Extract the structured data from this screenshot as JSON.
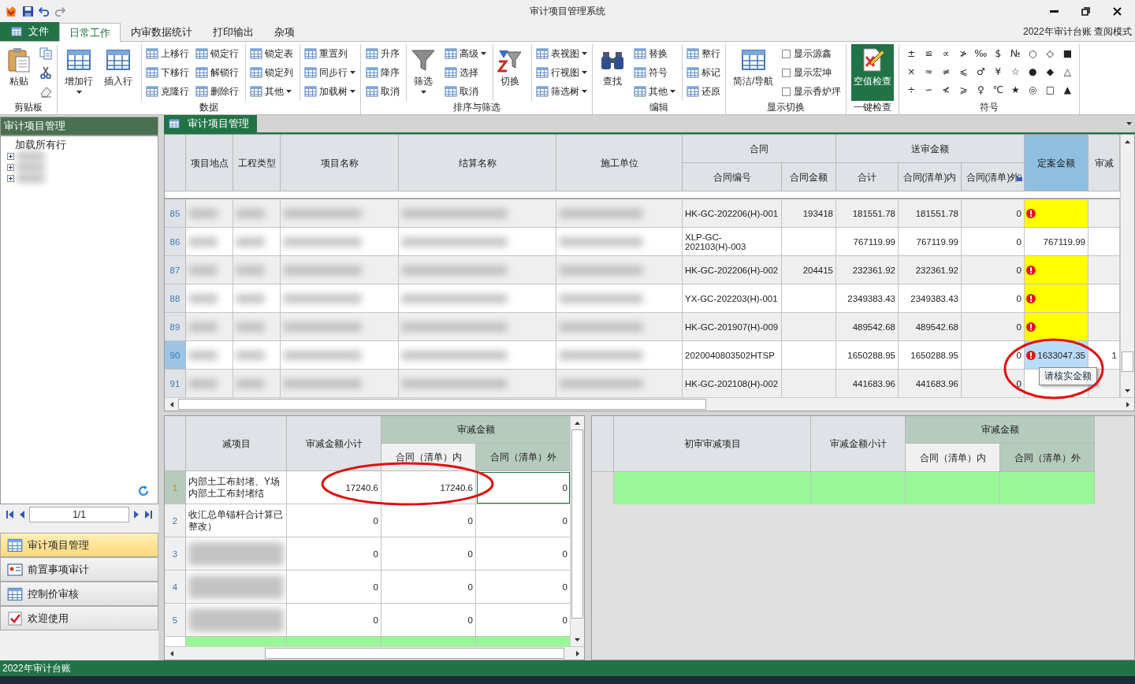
{
  "window": {
    "title": "审计项目管理系统"
  },
  "file_tab": {
    "label": "文件"
  },
  "ribbon_tabs": [
    {
      "label": "日常工作",
      "selected": true
    },
    {
      "label": "内审数据统计",
      "selected": false
    },
    {
      "label": "打印输出",
      "selected": false
    },
    {
      "label": "杂项",
      "selected": false
    }
  ],
  "mode_text": "2022年审计台账 查阅模式",
  "ribbon": {
    "groups": [
      {
        "label": "剪贴板",
        "columns": [
          {
            "divider": false,
            "items": [
              {
                "kind": "large",
                "label": "粘贴",
                "dropdown": false
              }
            ]
          },
          {
            "divider": false,
            "items": [
              {
                "kind": "icon"
              },
              {
                "kind": "icon"
              },
              {
                "kind": "icon"
              }
            ]
          }
        ]
      },
      {
        "label": "数据",
        "columns": [
          {
            "divider": false,
            "items": [
              {
                "kind": "large",
                "label": "增加行",
                "dropdown": true
              }
            ]
          },
          {
            "divider": false,
            "items": [
              {
                "kind": "large",
                "label": "插入行",
                "dropdown": false
              }
            ]
          },
          {
            "divider": true,
            "items": [
              {
                "kind": "small",
                "label": "上移行",
                "dropdown": false
              },
              {
                "kind": "small",
                "label": "下移行",
                "dropdown": false
              },
              {
                "kind": "small",
                "label": "克隆行",
                "dropdown": false
              }
            ]
          },
          {
            "divider": false,
            "items": [
              {
                "kind": "small",
                "label": "锁定行",
                "dropdown": false
              },
              {
                "kind": "small",
                "label": "解锁行",
                "dropdown": false
              },
              {
                "kind": "small",
                "label": "删除行",
                "dropdown": false
              }
            ]
          },
          {
            "divider": true,
            "items": [
              {
                "kind": "small",
                "label": "锁定表",
                "dropdown": false
              },
              {
                "kind": "small",
                "label": "锁定列",
                "dropdown": false
              },
              {
                "kind": "small",
                "label": "其他",
                "dropdown": true
              }
            ]
          },
          {
            "divider": true,
            "items": [
              {
                "kind": "small",
                "label": "重置列",
                "dropdown": false
              },
              {
                "kind": "small",
                "label": "同步行",
                "dropdown": true
              },
              {
                "kind": "small",
                "label": "加载树",
                "dropdown": true
              }
            ]
          }
        ]
      },
      {
        "label": "排序与筛选",
        "columns": [
          {
            "divider": false,
            "items": [
              {
                "kind": "small",
                "label": "升序",
                "dropdown": false
              },
              {
                "kind": "small",
                "label": "降序",
                "dropdown": false
              },
              {
                "kind": "small",
                "label": "取消",
                "dropdown": false
              }
            ]
          },
          {
            "divider": true,
            "items": [
              {
                "kind": "large",
                "label": "筛选",
                "dropdown": true
              }
            ]
          },
          {
            "divider": false,
            "items": [
              {
                "kind": "small",
                "label": "高级",
                "dropdown": true
              },
              {
                "kind": "small",
                "label": "选择",
                "dropdown": false
              },
              {
                "kind": "small",
                "label": "取消",
                "dropdown": false
              }
            ]
          },
          {
            "divider": true,
            "items": [
              {
                "kind": "large",
                "label": "切换",
                "dropdown": false
              }
            ]
          },
          {
            "divider": true,
            "items": [
              {
                "kind": "small",
                "label": "表视图",
                "dropdown": true
              },
              {
                "kind": "small",
                "label": "行视图",
                "dropdown": true
              },
              {
                "kind": "small",
                "label": "筛选树",
                "dropdown": true
              }
            ]
          }
        ]
      },
      {
        "label": "编辑",
        "columns": [
          {
            "divider": false,
            "items": [
              {
                "kind": "large",
                "label": "查找",
                "dropdown": false
              }
            ]
          },
          {
            "divider": false,
            "items": [
              {
                "kind": "small",
                "label": "替换",
                "dropdown": false
              },
              {
                "kind": "small",
                "label": "符号",
                "dropdown": false
              },
              {
                "kind": "small",
                "label": "其他",
                "dropdown": true
              }
            ]
          },
          {
            "divider": true,
            "items": [
              {
                "kind": "small",
                "label": "整行",
                "dropdown": false
              },
              {
                "kind": "small",
                "label": "标记",
                "dropdown": false
              },
              {
                "kind": "small",
                "label": "还原",
                "dropdown": false
              }
            ]
          }
        ]
      },
      {
        "label": "显示切换",
        "columns": [
          {
            "divider": false,
            "items": [
              {
                "kind": "large",
                "label": "简洁/导航",
                "dropdown": false
              }
            ]
          },
          {
            "divider": false,
            "items": [
              {
                "kind": "check",
                "label": "显示源鑫",
                "checked": false
              },
              {
                "kind": "check",
                "label": "显示宏坤",
                "checked": false
              },
              {
                "kind": "check",
                "label": "显示香炉坪",
                "checked": false
              }
            ]
          }
        ]
      },
      {
        "label": "一键检查",
        "columns": [
          {
            "divider": false,
            "items": [
              {
                "kind": "accent",
                "label": "空值检查",
                "dropdown": false
              }
            ]
          }
        ]
      },
      {
        "label": "符号",
        "symbols": [
          [
            "±",
            "≌",
            "∝",
            "≯",
            "‰",
            "$",
            "№",
            "○",
            "◇",
            "■"
          ],
          [
            "×",
            "≈",
            "≠",
            "⩽",
            "♂",
            "¥",
            "☆",
            "●",
            "◆",
            "△"
          ],
          [
            "÷",
            "∽",
            "≮",
            "⩾",
            "♀",
            "℃",
            "★",
            "◎",
            "□",
            "▲"
          ]
        ]
      }
    ]
  },
  "left_panel": {
    "title": "审计项目管理",
    "tree": [
      {
        "label": "加载所有行"
      },
      {
        "expanded": false
      },
      {
        "expanded": false
      },
      {
        "expanded": false
      }
    ],
    "pager": "1/1",
    "nav": [
      {
        "label": "审计项目管理",
        "selected": true
      },
      {
        "label": "前置事项审计",
        "selected": false
      },
      {
        "label": "控制价审核",
        "selected": false
      },
      {
        "label": "欢迎使用",
        "selected": false
      }
    ]
  },
  "main_tab": {
    "label": "审计项目管理"
  },
  "upper_grid": {
    "columns": [
      {
        "label": "项目地点",
        "highlighted": false,
        "locked": false
      },
      {
        "label": "工程类型",
        "highlighted": false,
        "locked": false
      },
      {
        "label": "项目名称",
        "highlighted": false,
        "locked": false
      },
      {
        "label": "结算名称",
        "highlighted": false,
        "locked": false
      },
      {
        "label": "施工单位",
        "highlighted": false,
        "locked": false
      },
      {
        "label": "合同",
        "children": [
          {
            "label": "合同编号",
            "highlighted": false,
            "locked": false
          },
          {
            "label": "合同金额",
            "highlighted": false,
            "locked": false
          }
        ]
      },
      {
        "label": "送审金额",
        "children": [
          {
            "label": "合计",
            "highlighted": false,
            "locked": false
          },
          {
            "label": "合同(清单)内",
            "highlighted": false,
            "locked": false
          },
          {
            "label": "合同(清单)外",
            "highlighted": false,
            "locked": true
          }
        ]
      },
      {
        "label": "定案金额",
        "highlighted": true,
        "locked": false
      },
      {
        "label": "审减",
        "highlighted": false,
        "locked": false
      }
    ],
    "rows": [
      {
        "number": "85",
        "selected": false,
        "contract_no": "HK-GC-202206(H)-001",
        "contract_amount": "193418",
        "total": "181551.78",
        "inside": "181551.78",
        "outside": "0",
        "final": {
          "kind": "missing"
        }
      },
      {
        "number": "86",
        "selected": false,
        "contract_no": "XLP-GC-202103(H)-003",
        "total": "767119.99",
        "inside": "767119.99",
        "outside": "0",
        "final": {
          "kind": "ok",
          "value": "767119.99"
        }
      },
      {
        "number": "87",
        "selected": false,
        "contract_no": "HK-GC-202206(H)-002",
        "contract_amount": "204415",
        "total": "232361.92",
        "inside": "232361.92",
        "outside": "0",
        "final": {
          "kind": "missing"
        }
      },
      {
        "number": "88",
        "selected": false,
        "contract_no": "YX-GC-202203(H)-001",
        "total": "2349383.43",
        "inside": "2349383.43",
        "outside": "0",
        "final": {
          "kind": "missing"
        }
      },
      {
        "number": "89",
        "selected": false,
        "contract_no": "HK-GC-201907(H)-009",
        "total": "489542.68",
        "inside": "489542.68",
        "outside": "0",
        "final": {
          "kind": "missing"
        }
      },
      {
        "number": "90",
        "selected": true,
        "contract_no": "2020040803502HTSP",
        "total": "1650288.95",
        "inside": "1650288.95",
        "outside": "0",
        "final": {
          "kind": "flagged",
          "value": "1633047.35"
        },
        "audit_cut": "1"
      },
      {
        "number": "91",
        "selected": false,
        "contract_no": "HK-GC-202108(H)-002",
        "total": "441683.96",
        "inside": "441683.96",
        "outside": "0",
        "final": {
          "kind": "covered"
        }
      }
    ]
  },
  "tooltip": {
    "text": "请核实金额"
  },
  "lower_left_grid": {
    "columns": [
      {
        "label": "减项目",
        "highlighted": false
      },
      {
        "label": "审减金额小计",
        "highlighted": false
      },
      {
        "label": "审减金额",
        "highlighted": true,
        "children": [
          {
            "label": "合同（清单）内",
            "highlighted": false
          },
          {
            "label": "合同（清单）外",
            "highlighted": true
          }
        ]
      }
    ],
    "rows": [
      {
        "number": "1",
        "selected": true,
        "item": "内部土工布封堵、Y场内部土工布封堵结",
        "subtotal": "17240.6",
        "inside": "17240.6",
        "outside": "0"
      },
      {
        "number": "2",
        "selected": false,
        "item": "收汇总单锚杆合计算已整改）",
        "subtotal": "0",
        "inside": "0",
        "outside": "0"
      },
      {
        "number": "3",
        "selected": false,
        "subtotal": "0",
        "inside": "0",
        "outside": "0"
      },
      {
        "number": "4",
        "selected": false,
        "subtotal": "0",
        "inside": "0",
        "outside": "0"
      },
      {
        "number": "5",
        "selected": false,
        "subtotal": "0",
        "inside": "0",
        "outside": "0"
      }
    ]
  },
  "lower_right_grid": {
    "columns": [
      {
        "label": "初审审减项目",
        "highlighted": false
      },
      {
        "label": "审减金额小计",
        "highlighted": false
      },
      {
        "label": "审减金额",
        "highlighted": true,
        "children": [
          {
            "label": "合同（清单）内",
            "highlighted": false
          },
          {
            "label": "合同（清单）外",
            "highlighted": true
          }
        ]
      }
    ]
  },
  "status_bar": {
    "text": "2022年审计台账"
  }
}
